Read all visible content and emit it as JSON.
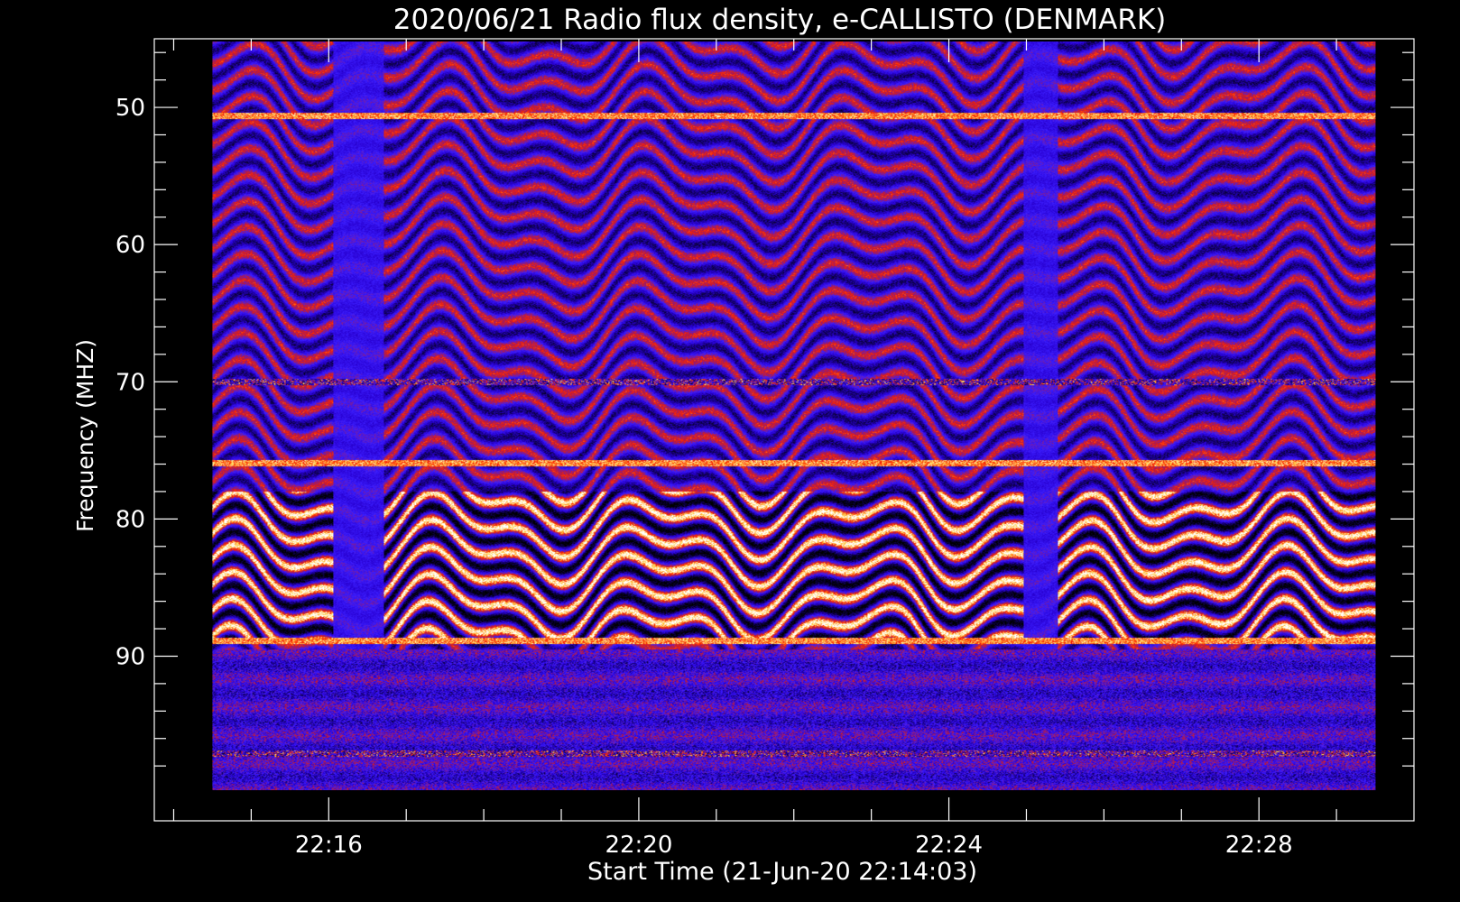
{
  "chart_data": {
    "type": "heatmap",
    "title": "2020/06/21  Radio flux density, e-CALLISTO (DENMARK)",
    "xlabel": "Start Time (21-Jun-20 22:14:03)",
    "ylabel": "Frequency (MHZ)",
    "x_ticks": [
      "22:16",
      "22:20",
      "22:24",
      "22:28"
    ],
    "x_tick_minutes": [
      1.95,
      5.95,
      9.95,
      13.95
    ],
    "x_range_minutes": [
      -0.3,
      15.95
    ],
    "data_x_range_minutes": [
      0.45,
      15.45
    ],
    "y_ticks": [
      50,
      60,
      70,
      80,
      90
    ],
    "y_range": [
      45,
      102
    ],
    "y_inverted": true,
    "data_y_range": [
      45.2,
      99.8
    ],
    "colorscale": [
      "#000000",
      "#2b00d9",
      "#3a1cff",
      "#b81a3a",
      "#ff2a00",
      "#ffd040",
      "#ffffff"
    ],
    "features": {
      "hlines_mhz": [
        50.6,
        70.0,
        75.9,
        88.9,
        97.1
      ],
      "bright_band_mhz": [
        78,
        89
      ],
      "quiet_gaps_minutes": [
        [
          2.0,
          2.65
        ],
        [
          10.9,
          11.35
        ]
      ]
    }
  }
}
